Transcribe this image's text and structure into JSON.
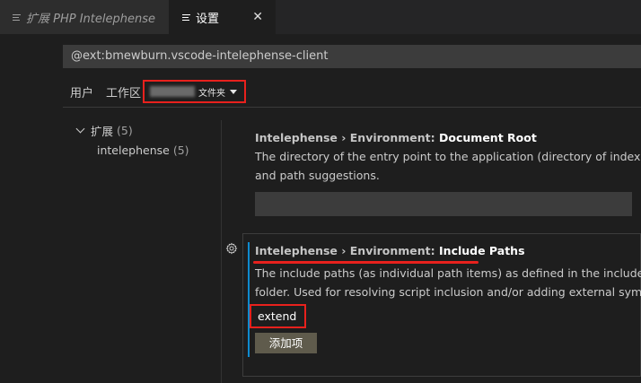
{
  "tabs": [
    {
      "title": "扩展 PHP Intelephense",
      "active": false
    },
    {
      "title": "设置",
      "active": true,
      "close": "✕"
    }
  ],
  "search": {
    "value": "@ext:bmewburn.vscode-intelephense-client"
  },
  "scopes": {
    "user": "用户",
    "workspace": "工作区",
    "folder_label": "文件夹"
  },
  "toc": {
    "group": {
      "label": "扩展",
      "count": "(5)"
    },
    "child": {
      "label": "intelephense",
      "count": "(5)"
    }
  },
  "settings": [
    {
      "category": "Intelephense › Environment: ",
      "name": "Document Root",
      "desc_lines": [
        "The directory of the entry point to the application (directory of index.php). C",
        "and path suggestions."
      ]
    },
    {
      "category": "Intelephense › Environment: ",
      "name": "Include Paths",
      "desc_lines": [
        "The include paths (as individual path items) as defined in the include_path i",
        "folder. Used for resolving script inclusion and/or adding external symbols to"
      ],
      "item": "extend",
      "add_button": "添加项"
    }
  ],
  "colors": {
    "accent": "#0e8bcf",
    "annotation": "#e8211d"
  }
}
